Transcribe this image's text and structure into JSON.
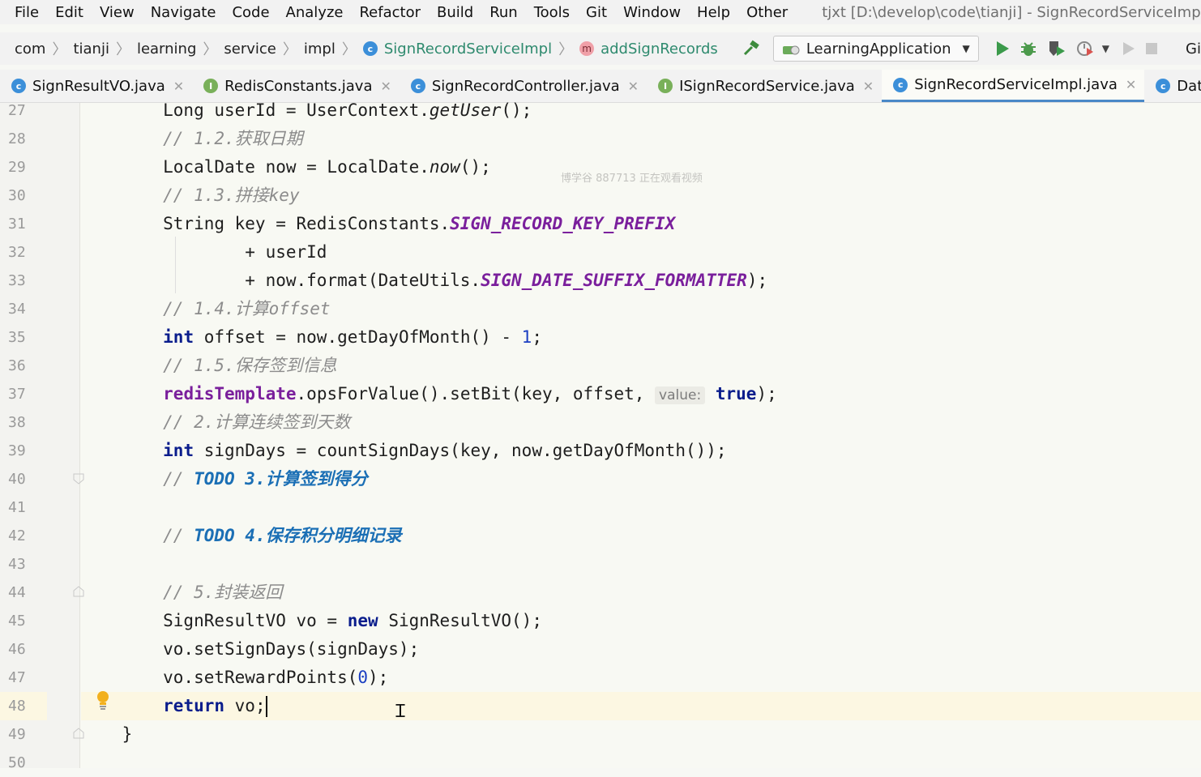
{
  "menu": {
    "items": [
      "File",
      "Edit",
      "View",
      "Navigate",
      "Code",
      "Analyze",
      "Refactor",
      "Build",
      "Run",
      "Tools",
      "Git",
      "Window",
      "Help",
      "Other"
    ],
    "window_title": "tjxt [D:\\develop\\code\\tianji] - SignRecordServiceImpl.java [tj-lea"
  },
  "breadcrumb": {
    "items": [
      "com",
      "tianji",
      "learning",
      "service",
      "impl"
    ],
    "class_name": "SignRecordServiceImpl",
    "method_name": "addSignRecords"
  },
  "toolbar": {
    "run_config": "LearningApplication",
    "git_label": "Git:"
  },
  "tabs": [
    {
      "label": "SignResultVO.java",
      "icon": "class-icon",
      "active": false
    },
    {
      "label": "RedisConstants.java",
      "icon": "interface-icon",
      "active": false
    },
    {
      "label": "SignRecordController.java",
      "icon": "class-icon",
      "active": false
    },
    {
      "label": "ISignRecordService.java",
      "icon": "interface-icon",
      "active": false
    },
    {
      "label": "SignRecordServiceImpl.java",
      "icon": "class-icon",
      "active": true
    },
    {
      "label": "DateUtils.jav",
      "icon": "class-icon",
      "active": false
    }
  ],
  "watermark": "博学谷 887713 正在观看视频",
  "editor": {
    "line_numbers": [
      "27",
      "28",
      "29",
      "30",
      "31",
      "32",
      "33",
      "34",
      "35",
      "36",
      "37",
      "38",
      "39",
      "40",
      "41",
      "42",
      "43",
      "44",
      "45",
      "46",
      "47",
      "48",
      "49",
      "50"
    ],
    "current_line": "48",
    "param_hint": "value:",
    "colors": {
      "keyword": "#0a1d8c",
      "comment": "#8c8c8c",
      "todo": "#1b6fb5",
      "static_field": "#7a1f9c",
      "number": "#1b3fc2",
      "current_line_bg": "#fcf7e2"
    }
  }
}
